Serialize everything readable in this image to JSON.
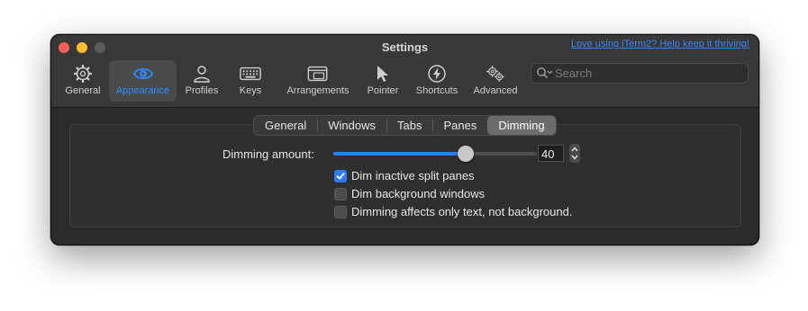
{
  "window": {
    "title": "Settings",
    "promo_link": "Love using iTerm2? Help keep it thriving!"
  },
  "toolbar": {
    "items": [
      {
        "label": "General",
        "icon": "gear-icon"
      },
      {
        "label": "Appearance",
        "icon": "eye-icon",
        "selected": true
      },
      {
        "label": "Profiles",
        "icon": "person-icon"
      },
      {
        "label": "Keys",
        "icon": "keyboard-icon"
      },
      {
        "label": "Arrangements",
        "icon": "windows-icon"
      },
      {
        "label": "Pointer",
        "icon": "pointer-icon"
      },
      {
        "label": "Shortcuts",
        "icon": "bolt-icon"
      },
      {
        "label": "Advanced",
        "icon": "gears-icon"
      }
    ],
    "search_placeholder": "Search"
  },
  "tabs": {
    "items": [
      "General",
      "Windows",
      "Tabs",
      "Panes",
      "Dimming"
    ],
    "active": "Dimming"
  },
  "dimming": {
    "amount_label": "Dimming amount:",
    "amount_value": "40",
    "slider_fraction": 0.65,
    "options": [
      {
        "label": "Dim inactive split panes",
        "checked": true
      },
      {
        "label": "Dim background windows",
        "checked": false
      },
      {
        "label": "Dimming affects only text, not background.",
        "checked": false
      }
    ]
  },
  "colors": {
    "accent": "#2e7cf6",
    "window_bg": "#2b2b2c",
    "titlebar_bg": "#383838"
  }
}
